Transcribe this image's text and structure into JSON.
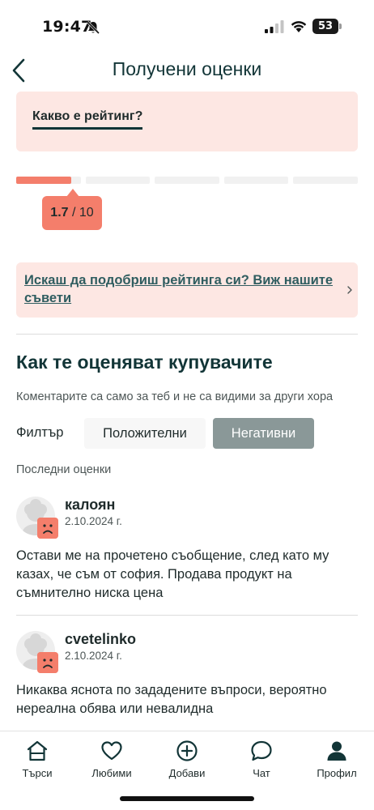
{
  "status_bar": {
    "time": "19:47",
    "battery": "53",
    "icons": [
      "bell-slash-icon",
      "signal-icon",
      "wifi-icon",
      "battery-icon"
    ]
  },
  "header": {
    "title": "Получени оценки",
    "back_icon": "chevron-left-icon"
  },
  "rating_info": {
    "link_label": "Какво е рейтинг?"
  },
  "rating": {
    "value": "1.7",
    "max": "/ 10",
    "fraction": 0.17,
    "segments": 5
  },
  "tips": {
    "link_label": "Искаш да подобриш рейтинга си? Виж нашите съвети",
    "chevron_icon": "chevron-right-icon"
  },
  "section": {
    "title": "Как те оценяват купувачите",
    "subtitle": "Коментарите са само за теб и не са видими за други хора"
  },
  "filter": {
    "label": "Филтър",
    "positive": "Положителни",
    "negative": "Негативни",
    "selected": "negative"
  },
  "recent_label": "Последни оценки",
  "reviews": [
    {
      "name": "калоян",
      "date": "2.10.2024 г.",
      "sentiment": "negative",
      "text": "Остави ме на прочетено съобщение, след като му казах, че съм от софия. Продава продукт на съмнително ниска цена"
    },
    {
      "name": "cvetelinko",
      "date": "2.10.2024 г.",
      "sentiment": "negative",
      "text": "Никаква яснота по зададените въпроси, вероятно нереална обява или невалидна"
    }
  ],
  "bottom_nav": {
    "items": [
      {
        "label": "Търси",
        "icon": "home-icon"
      },
      {
        "label": "Любими",
        "icon": "heart-icon"
      },
      {
        "label": "Добави",
        "icon": "plus-circle-icon"
      },
      {
        "label": "Чат",
        "icon": "chat-bubble-icon"
      },
      {
        "label": "Профил",
        "icon": "person-icon"
      }
    ],
    "active": "Профил"
  },
  "colors": {
    "accent": "#f47e6b",
    "card_bg": "#fde7e3",
    "title": "#123537",
    "link": "#2f5d60",
    "selected_filter": "#8a9898"
  }
}
